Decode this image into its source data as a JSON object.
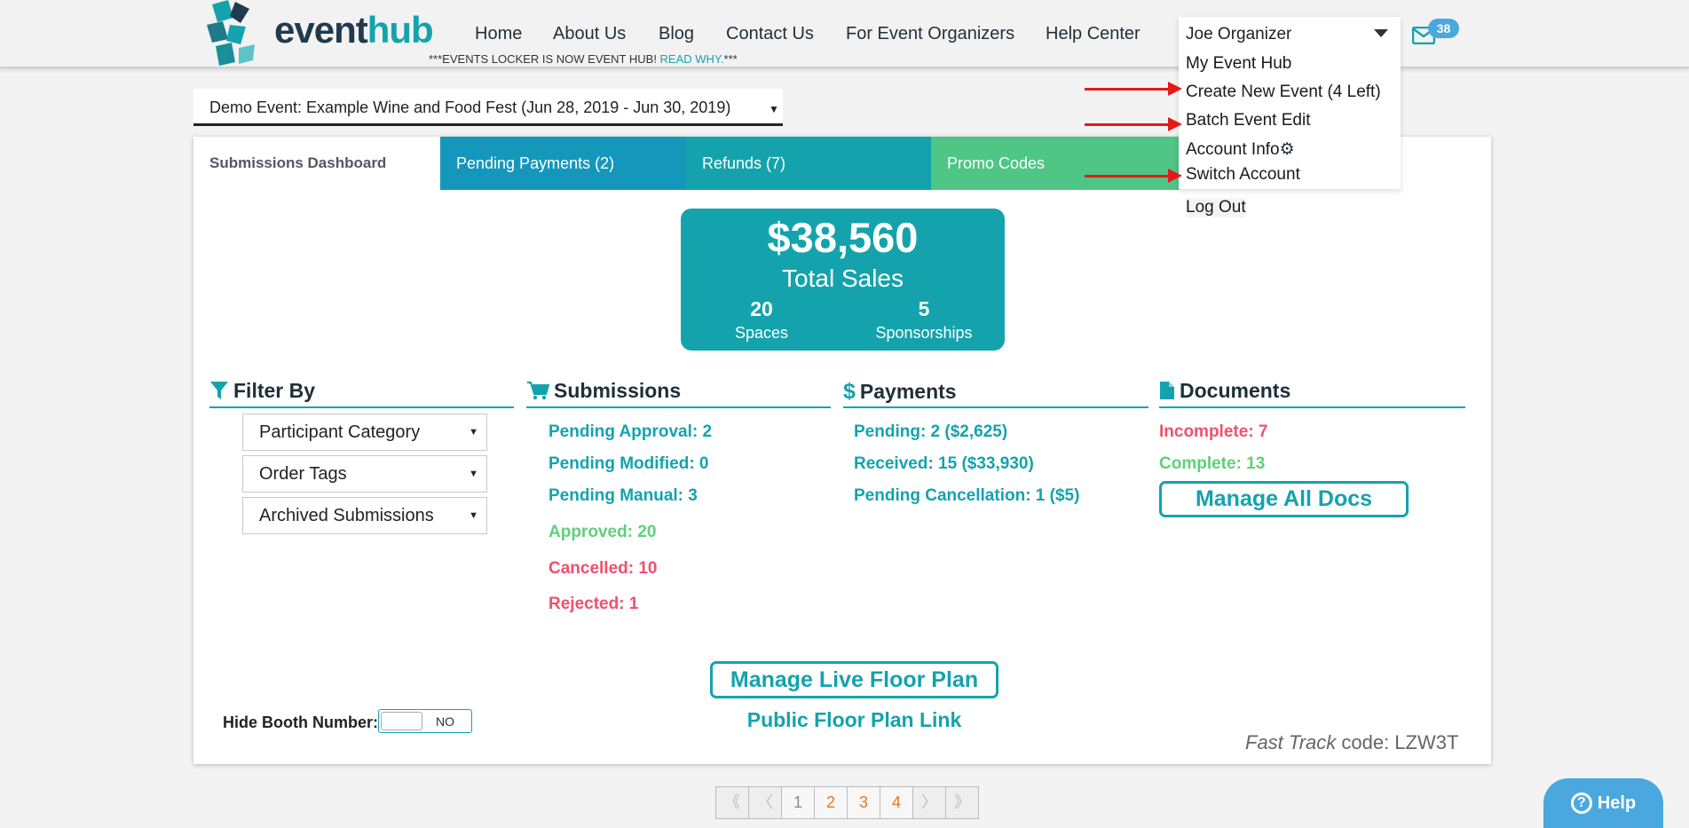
{
  "brand": {
    "name_part1": "event",
    "name_part2": "hub",
    "tagline_prefix": "***EVENTS LOCKER IS NOW EVENT HUB! ",
    "tagline_link": "READ WHY.",
    "tagline_suffix": "***"
  },
  "nav": [
    {
      "label": "Home"
    },
    {
      "label": "About Us"
    },
    {
      "label": "Blog"
    },
    {
      "label": "Contact Us"
    },
    {
      "label": "For Event Organizers"
    },
    {
      "label": "Help Center"
    }
  ],
  "user_menu": {
    "user_name": "Joe Organizer",
    "items": [
      {
        "label": "My Event Hub"
      },
      {
        "label": "Create New Event (4 Left)"
      },
      {
        "label": "Batch Event Edit"
      },
      {
        "label": "Account Info"
      },
      {
        "label": "Switch Account"
      },
      {
        "label": "Log Out"
      }
    ]
  },
  "mail": {
    "count": "38"
  },
  "event_select": {
    "value": "Demo Event: Example Wine and Food Fest (Jun 28, 2019 - Jun 30, 2019)"
  },
  "tabs": [
    {
      "label": "Submissions Dashboard"
    },
    {
      "label": "Pending Payments (2)"
    },
    {
      "label": "Refunds (7)"
    },
    {
      "label": "Promo Codes"
    }
  ],
  "sales": {
    "amount": "$38,560",
    "label": "Total Sales",
    "spaces_count": "20",
    "spaces_label": "Spaces",
    "sponsorships_count": "5",
    "sponsorships_label": "Sponsorships"
  },
  "filter": {
    "heading": "Filter By",
    "dropdowns": [
      {
        "label": "Participant Category"
      },
      {
        "label": "Order Tags"
      },
      {
        "label": "Archived Submissions"
      }
    ]
  },
  "submissions": {
    "heading": "Submissions",
    "pending_approval": "Pending Approval: 2",
    "pending_modified": "Pending Modified: 0",
    "pending_manual": "Pending Manual: 3",
    "approved": "Approved: 20",
    "cancelled": "Cancelled: 10",
    "rejected": "Rejected: 1"
  },
  "payments": {
    "heading": "Payments",
    "pending": "Pending: 2 ($2,625)",
    "received": "Received: 15 ($33,930)",
    "pending_cancellation": "Pending Cancellation: 1 ($5)"
  },
  "documents": {
    "heading": "Documents",
    "incomplete": "Incomplete: 7",
    "complete": "Complete: 13",
    "manage_button": "Manage All Docs"
  },
  "floor_plan": {
    "manage_button": "Manage Live Floor Plan",
    "public_link": "Public Floor Plan Link"
  },
  "hide_booth": {
    "label": "Hide Booth Number:",
    "toggle_value": "NO"
  },
  "fast_track": {
    "prefix": "Fast Track",
    "suffix": " code: LZW3T"
  },
  "pagination": [
    {
      "label": "《"
    },
    {
      "label": "〈"
    },
    {
      "label": "1"
    },
    {
      "label": "2"
    },
    {
      "label": "3"
    },
    {
      "label": "4"
    },
    {
      "label": "〉"
    },
    {
      "label": "》"
    }
  ],
  "help_button": {
    "label": "Help"
  },
  "colors": {
    "teal": "#14a3ad",
    "blue_tab": "#1597bb",
    "green_tab": "#4fc586",
    "green_text": "#5fd07a",
    "red_text": "#f0506e",
    "arrow_red": "#e41a1a",
    "help_blue": "#4aa8df"
  }
}
